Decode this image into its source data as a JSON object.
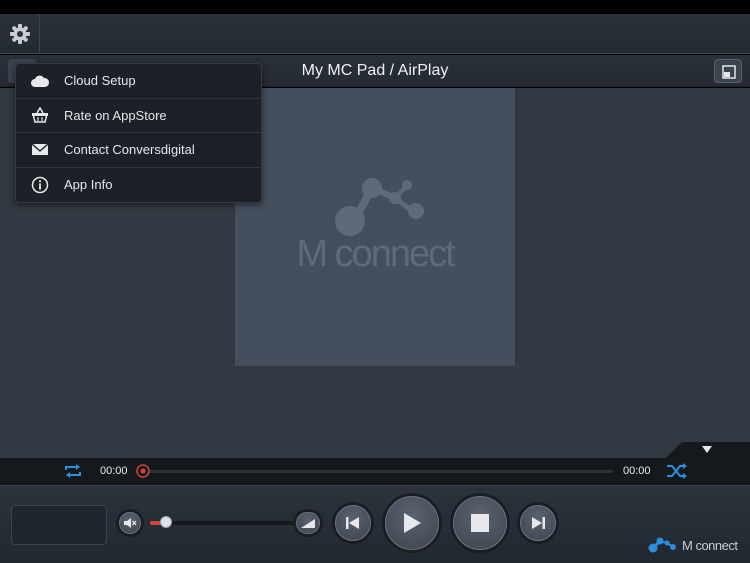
{
  "header": {
    "zone_title": "My MC Pad / AirPlay"
  },
  "menu": {
    "items": [
      {
        "label": "Cloud Setup",
        "icon": "cloud-icon"
      },
      {
        "label": "Rate on AppStore",
        "icon": "basket-icon"
      },
      {
        "label": "Contact Conversdigital",
        "icon": "mail-icon"
      },
      {
        "label": "App Info",
        "icon": "info-icon"
      }
    ]
  },
  "cover": {
    "brand_text": "M connect"
  },
  "progress": {
    "elapsed": "00:00",
    "total": "00:00",
    "position": 0
  },
  "volume": {
    "level": 0.08
  },
  "footer": {
    "brand_text": "M connect"
  },
  "colors": {
    "accent_blue": "#2a8fe0",
    "progress_red": "#d2443c",
    "background": "#323942"
  }
}
